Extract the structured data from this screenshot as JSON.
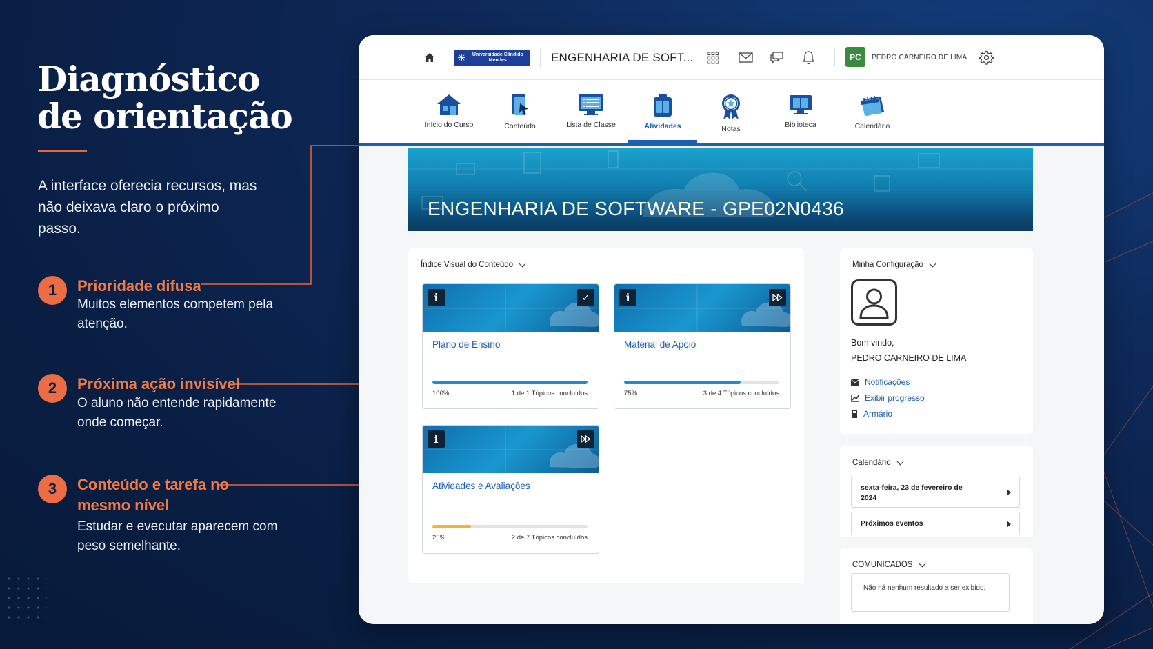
{
  "left": {
    "title_line1": "Diagnóstico",
    "title_line2": "de orientação",
    "subtitle": "A interface oferecia recursos, mas não deixava claro o próximo passo.",
    "points": [
      {
        "num": "1",
        "title": "Prioridade difusa",
        "body": "Muitos elementos competem pela atenção."
      },
      {
        "num": "2",
        "title": "Próxima ação invisível",
        "body": "O aluno não entende rapidamente onde começar."
      },
      {
        "num": "3",
        "title": "Conteúdo e tarefa no mesmo nível",
        "body": "Estudar e evecutar aparecem com peso semelhante."
      }
    ],
    "accent": "#ec6d43"
  },
  "topbar": {
    "logo_text": "Universidade Cândido Mendes",
    "course": "ENGENHARIA DE SOFT...",
    "avatar": "PC",
    "user": "PEDRO CARNEIRO DE LIMA",
    "icons": [
      "home-icon",
      "apps-grid-icon",
      "mail-icon",
      "chat-icon",
      "bell-icon",
      "gear-icon"
    ]
  },
  "nav": {
    "items": [
      {
        "label": "Início do Curso",
        "icon": "home-icon"
      },
      {
        "label": "Conteúdo",
        "icon": "content-icon"
      },
      {
        "label": "Lista de Classe",
        "icon": "classlist-icon"
      },
      {
        "label": "Atividades",
        "icon": "activities-icon",
        "active": true
      },
      {
        "label": "Notas",
        "icon": "grades-icon"
      },
      {
        "label": "Biblioteca",
        "icon": "library-icon"
      },
      {
        "label": "Calendário",
        "icon": "calendar-icon"
      }
    ],
    "accent": "#1a5fb4"
  },
  "banner": {
    "title": "ENGENHARIA DE SOFTWARE - GPE02N0436"
  },
  "content": {
    "header": "Índice Visual do Conteúdo",
    "cards": [
      {
        "title": "Plano de Ensino",
        "percent": "100%",
        "topics": "1 de 1 Tópicos concluídos",
        "progress": 1.0,
        "color": "#1a8fd0",
        "action": "check-icon"
      },
      {
        "title": "Material de Apoio",
        "percent": "75%",
        "topics": "3 de 4 Tópicos concluídos",
        "progress": 0.75,
        "color": "#1a8fd0",
        "action": "fast-forward-icon"
      },
      {
        "title": "Atividades e Avaliações",
        "percent": "25%",
        "topics": "2 de 7 Tópicos concluídos",
        "progress": 0.25,
        "color": "#f2b234",
        "action": "fast-forward-icon"
      }
    ]
  },
  "sidebar": {
    "config": {
      "header": "Minha Configuração",
      "greeting": "Bom vindo,",
      "name": "PEDRO CARNEIRO DE LIMA",
      "links": [
        {
          "label": "Notificações",
          "icon": "envelope-icon"
        },
        {
          "label": "Exibir progresso",
          "icon": "chart-icon"
        },
        {
          "label": "Armário",
          "icon": "locker-icon"
        }
      ]
    },
    "calendar": {
      "header": "Calendário",
      "date": "sexta-feira, 23 de fevereiro de 2024",
      "events": "Próximos eventos"
    },
    "announcements": {
      "header": "COMUNICADOS",
      "empty": "Não há nenhum resultado a ser exibido."
    }
  }
}
